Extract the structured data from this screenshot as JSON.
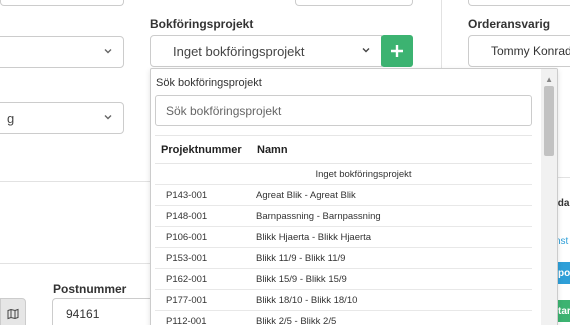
{
  "form": {
    "bokforingsprojekt_label": "Bokföringsprojekt",
    "bokforingsprojekt_value": "Inget bokföringsprojekt",
    "left_select_2_value": "g",
    "orderansvarig_label": "Orderansvarig",
    "orderansvarig_value": "Tommy Konrad",
    "postnummer_label": "Postnummer",
    "postnummer_value": "94161"
  },
  "add_button": {
    "symbol": "+",
    "icon": "plus-icon"
  },
  "dropdown": {
    "search_label": "Sök bokföringsprojekt",
    "search_placeholder": "Sök bokföringsprojekt",
    "columns": [
      "Projektnummer",
      "Namn"
    ],
    "none_option": "Inget bokföringsprojekt",
    "rows": [
      {
        "nr": "P143-001",
        "name": "Agreat Blik - Agreat Blik"
      },
      {
        "nr": "P148-001",
        "name": "Barnpassning - Barnpassning"
      },
      {
        "nr": "P106-001",
        "name": "Blikk Hjaerta - Blikk Hjaerta"
      },
      {
        "nr": "P153-001",
        "name": "Blikk 11/9 - Blikk 11/9"
      },
      {
        "nr": "P162-001",
        "name": "Blikk 15/9 - Blikk 15/9"
      },
      {
        "nr": "P177-001",
        "name": "Blikk 18/10 - Blikk 18/10"
      },
      {
        "nr": "P112-001",
        "name": "Blikk 2/5 - Blikk 2/5"
      }
    ]
  },
  "right_panel": {
    "text_1": "lda",
    "text_2": "nst",
    "button_1": "po",
    "button_2": "tar"
  },
  "colors": {
    "accent_green": "#3cb371",
    "accent_blue": "#2e9fd8"
  }
}
